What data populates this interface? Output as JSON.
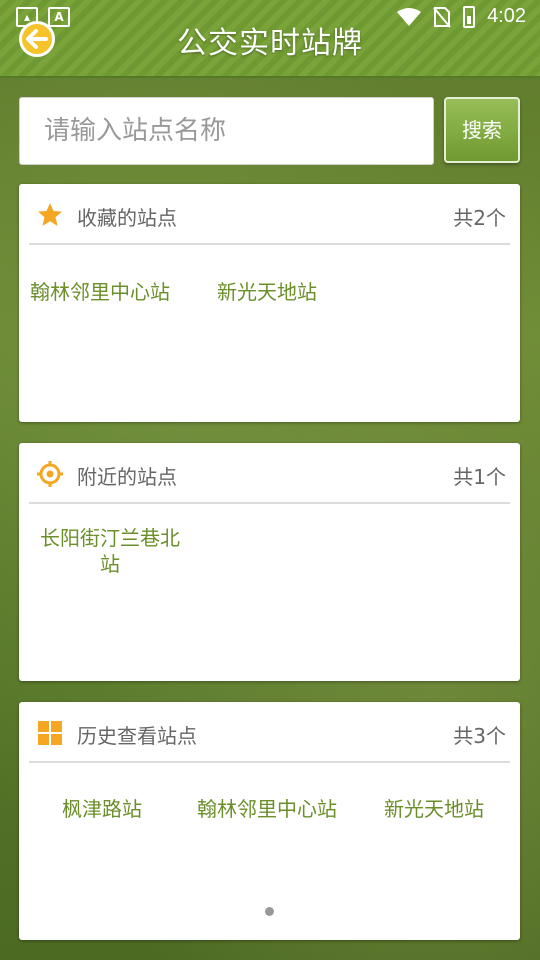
{
  "status_bar": {
    "time": "4:02",
    "left_icons": [
      "image-notification-icon",
      "text-notification-icon"
    ]
  },
  "header": {
    "title": "公交实时站牌"
  },
  "search": {
    "placeholder": "请输入站点名称",
    "button_label": "搜索"
  },
  "favorites": {
    "title": "收藏的站点",
    "count": "共2个",
    "stations": [
      "翰林邻里中心站",
      "新光天地站"
    ]
  },
  "nearby": {
    "title": "附近的站点",
    "count": "共1个",
    "station_line1": "长阳街汀兰巷北",
    "station_line2": "站"
  },
  "history": {
    "title": "历史查看站点",
    "count": "共3个",
    "stations": [
      "枫津路站",
      "翰林邻里中心站",
      "新光天地站"
    ]
  },
  "colors": {
    "header_green": "#7aa43a",
    "station_text": "#6b8f2a",
    "back_button": "#f6c42a",
    "icon_orange": "#f5a623"
  }
}
